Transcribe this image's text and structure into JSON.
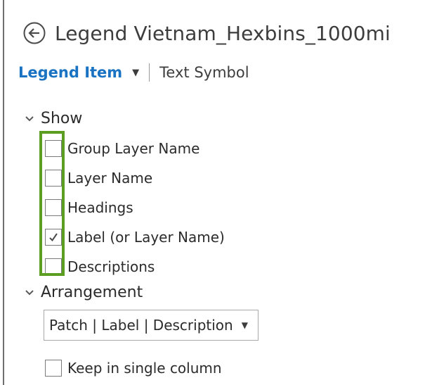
{
  "header": {
    "title": "Legend Vietnam_Hexbins_1000mi",
    "back_icon": "back-circle-arrow-icon"
  },
  "subnav": {
    "active_label": "Legend Item",
    "dropdown_caret": "▼",
    "other_label": "Text Symbol"
  },
  "show": {
    "title": "Show",
    "items": [
      {
        "label": "Group Layer Name",
        "checked": false
      },
      {
        "label": "Layer Name",
        "checked": false
      },
      {
        "label": "Headings",
        "checked": false
      },
      {
        "label": "Label (or Layer Name)",
        "checked": true
      },
      {
        "label": "Descriptions",
        "checked": false
      }
    ]
  },
  "arrangement": {
    "title": "Arrangement",
    "dropdown_value": "Patch | Label | Description",
    "dropdown_caret": "▼",
    "keep_single_column": {
      "label": "Keep in single column",
      "checked": false
    }
  },
  "colors": {
    "accent": "#1a73c2",
    "highlight": "#5b9e22"
  }
}
